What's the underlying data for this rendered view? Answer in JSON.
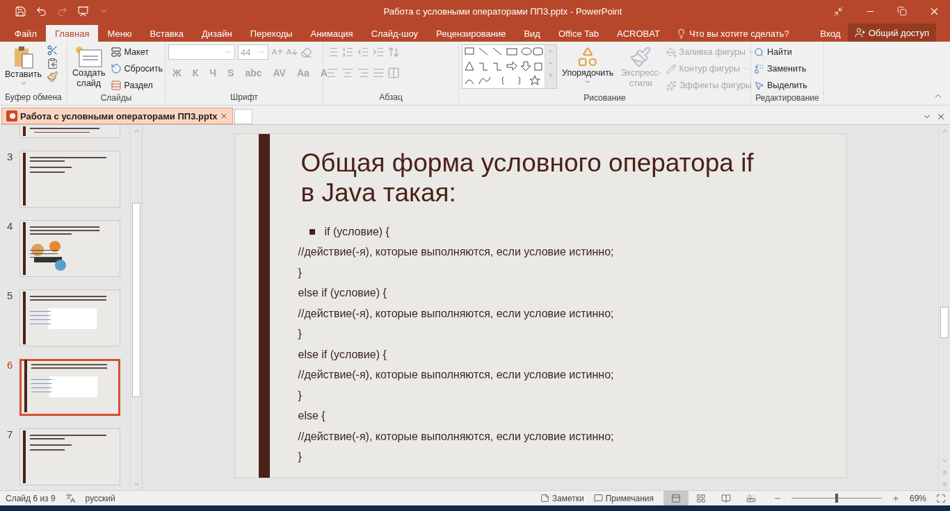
{
  "window": {
    "title": "Работа с условными операторами ПП3.pptx - PowerPoint"
  },
  "ribbon_tabs": [
    {
      "label": "Файл",
      "selected": false
    },
    {
      "label": "Главная",
      "selected": true
    },
    {
      "label": "Меню",
      "selected": false
    },
    {
      "label": "Вставка",
      "selected": false
    },
    {
      "label": "Дизайн",
      "selected": false
    },
    {
      "label": "Переходы",
      "selected": false
    },
    {
      "label": "Анимация",
      "selected": false
    },
    {
      "label": "Слайд-шоу",
      "selected": false
    },
    {
      "label": "Рецензирование",
      "selected": false
    },
    {
      "label": "Вид",
      "selected": false
    },
    {
      "label": "Office Tab",
      "selected": false
    },
    {
      "label": "ACROBAT",
      "selected": false
    }
  ],
  "tell_me": "Что вы хотите сделать?",
  "sign_in": "Вход",
  "share": "Общий доступ",
  "ribbon": {
    "clipboard": {
      "label": "Буфер обмена",
      "paste": "Вставить"
    },
    "slides": {
      "label": "Слайды",
      "new_slide": "Создать слайд",
      "layout": "Макет",
      "reset": "Сбросить",
      "section": "Раздел"
    },
    "font": {
      "label": "Шрифт",
      "size": "44",
      "disabled": true,
      "format_buttons": [
        "Ж",
        "К",
        "Ч",
        "S",
        "abc",
        "AV",
        "Aa"
      ],
      "color_button": "A"
    },
    "paragraph": {
      "label": "Абзац",
      "disabled": true
    },
    "drawing": {
      "label": "Рисование",
      "arrange": "Упорядочить",
      "quick_styles": "Экспресс-стили",
      "shape_commands": [
        {
          "label": "Заливка фигуры",
          "disabled": true
        },
        {
          "label": "Контур фигуры",
          "disabled": true
        },
        {
          "label": "Эффекты фигуры",
          "disabled": true
        }
      ]
    },
    "editing": {
      "label": "Редактирование",
      "commands": [
        {
          "kind": "find",
          "label": "Найти"
        },
        {
          "kind": "replace",
          "label": "Заменить"
        },
        {
          "kind": "select",
          "label": "Выделить"
        }
      ]
    }
  },
  "document_tab": {
    "title": "Работа с условными операторами ПП3.pptx"
  },
  "thumbnails": [
    {
      "kind": "text",
      "selected": false
    },
    {
      "number": "3",
      "kind": "text",
      "selected": false
    },
    {
      "number": "4",
      "kind": "image",
      "selected": false
    },
    {
      "number": "5",
      "kind": "code",
      "selected": false
    },
    {
      "number": "6",
      "kind": "code",
      "selected": true
    },
    {
      "number": "7",
      "kind": "text",
      "selected": false
    }
  ],
  "slide": {
    "title_lines": [
      "Общая форма условного оператора if",
      "в Java такая:"
    ],
    "lines": [
      {
        "text": "if (условие) {",
        "bullet": true
      },
      {
        "text": "//действие(-я), которые выполняются, если условие истинно;",
        "bullet": false
      },
      {
        "text": "}",
        "bullet": false
      },
      {
        "text": "else if (условие) {",
        "bullet": false
      },
      {
        "text": "//действие(-я), которые выполняются, если условие истинно;",
        "bullet": false
      },
      {
        "text": "}",
        "bullet": false
      },
      {
        "text": "else if (условие) {",
        "bullet": false
      },
      {
        "text": "//действие(-я), которые выполняются, если условие истинно;",
        "bullet": false
      },
      {
        "text": "}",
        "bullet": false
      },
      {
        "text": "else {",
        "bullet": false
      },
      {
        "text": "//действие(-я), которые выполняются, если условие истинно;",
        "bullet": false
      },
      {
        "text": "}",
        "bullet": false
      }
    ]
  },
  "status_bar": {
    "slide_info": "Слайд 6 из 9",
    "language": "русский",
    "notes": "Заметки",
    "comments": "Примечания",
    "views": [
      {
        "kind": "normal",
        "selected": true
      },
      {
        "kind": "sorter",
        "selected": false
      },
      {
        "kind": "reading",
        "selected": false
      },
      {
        "kind": "show",
        "selected": false
      }
    ],
    "zoom": {
      "level": 0.5,
      "reading": "69%"
    }
  }
}
